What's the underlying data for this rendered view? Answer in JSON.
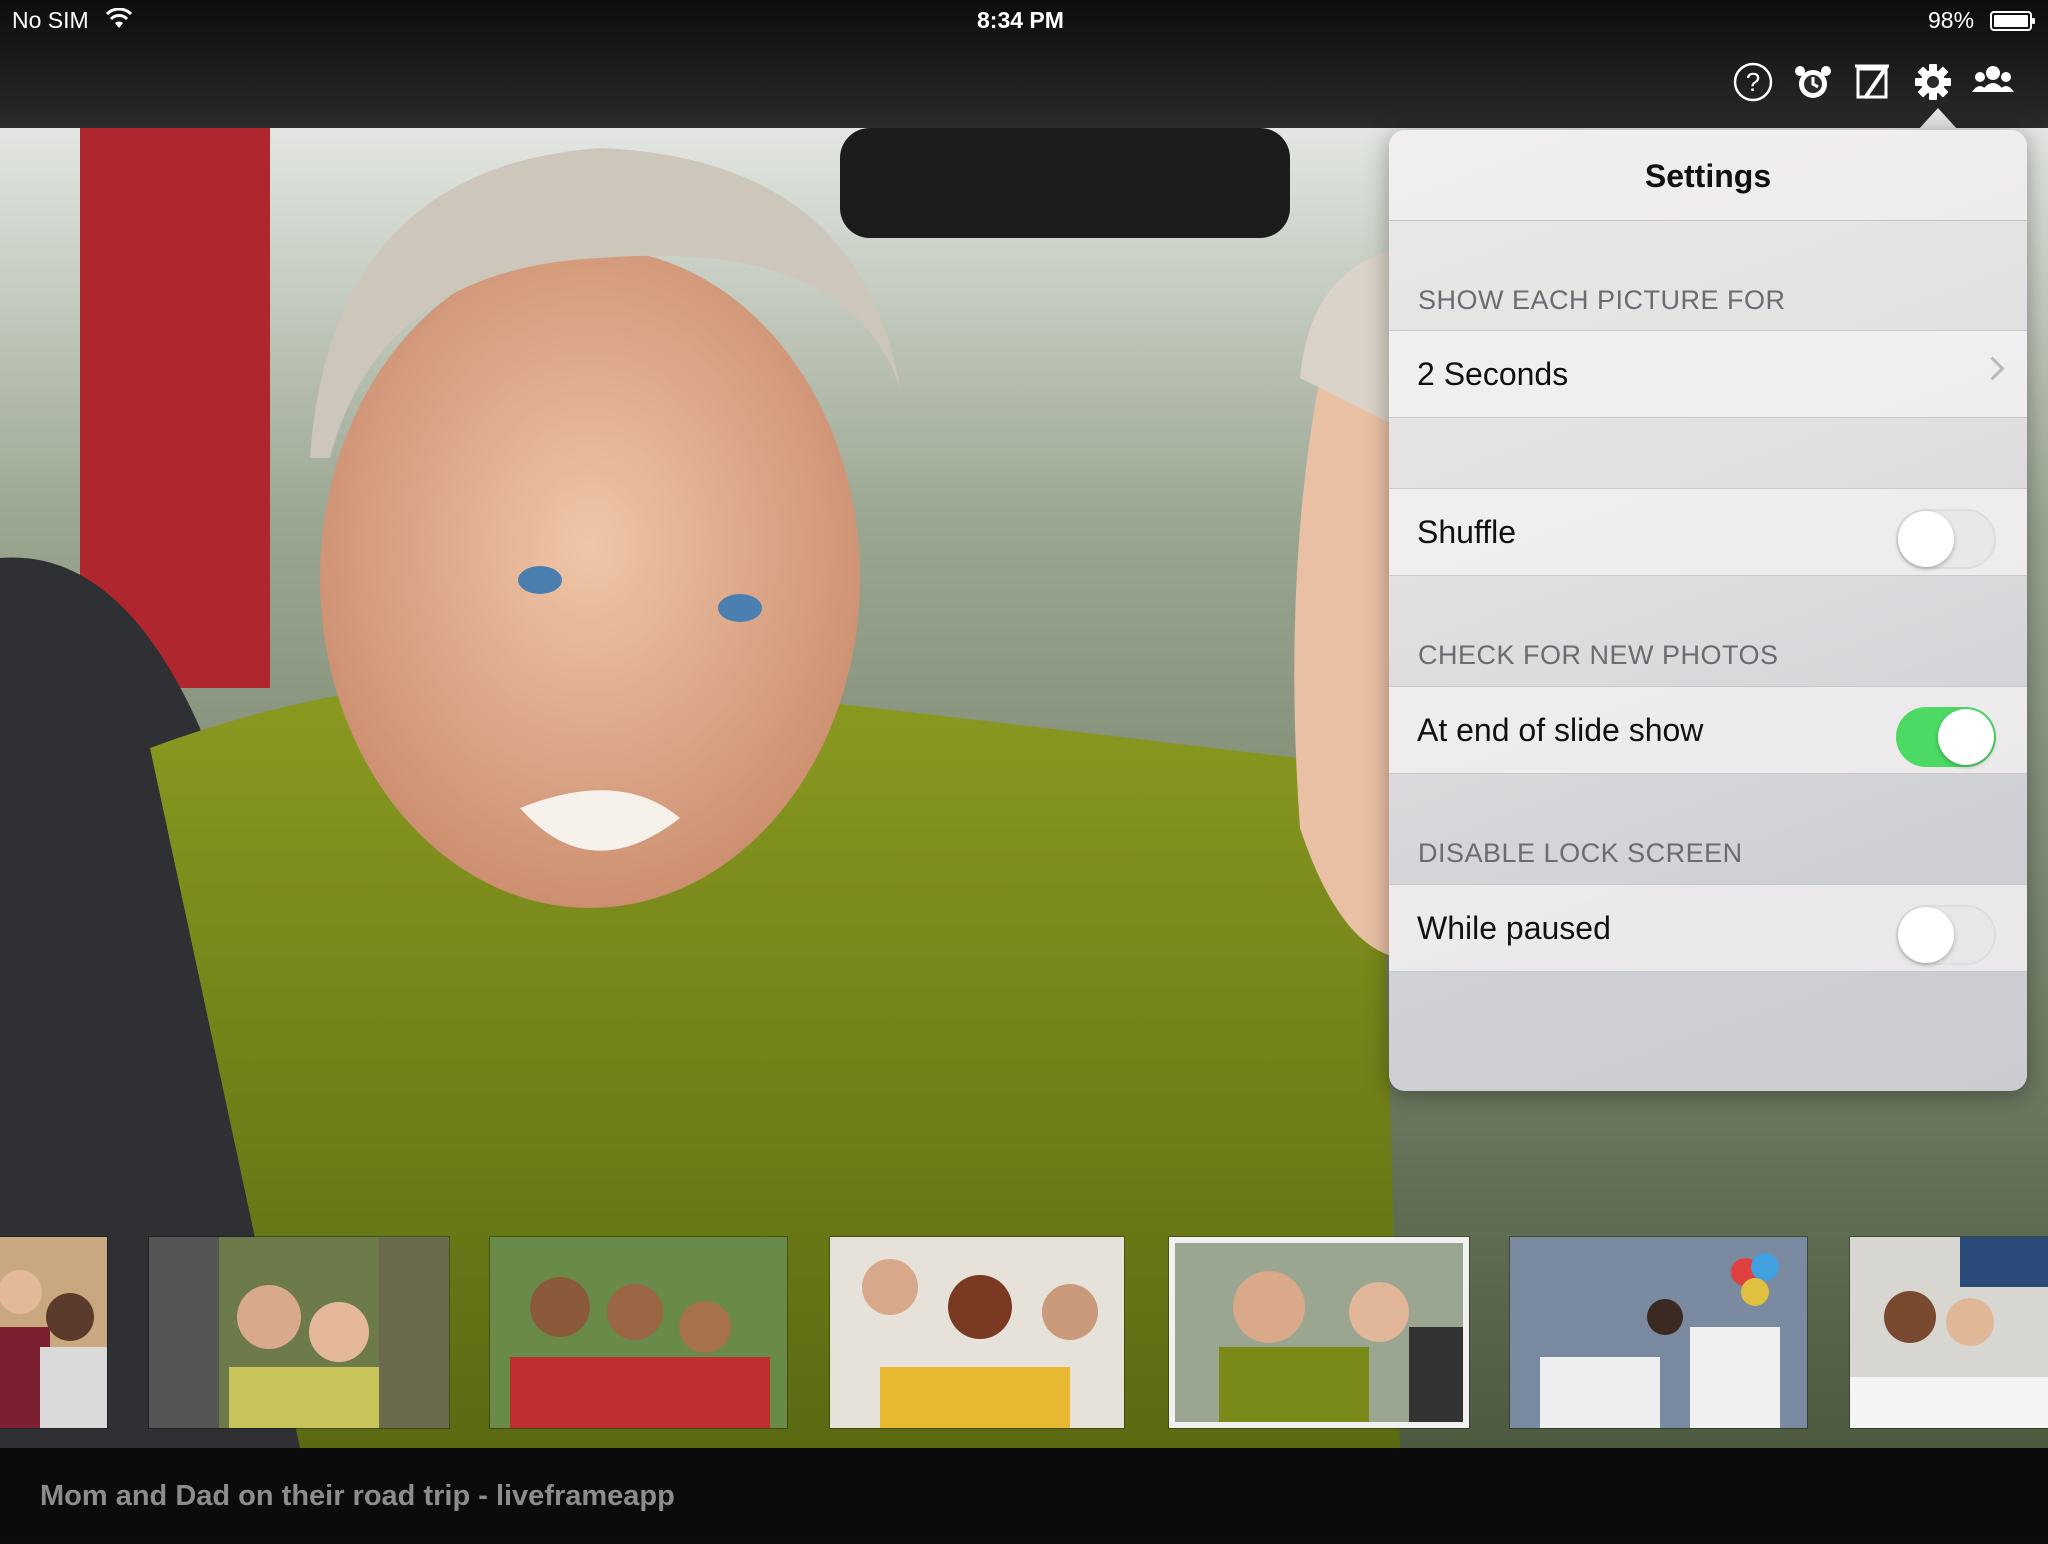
{
  "status_bar": {
    "carrier": "No SIM",
    "time": "8:34 PM",
    "battery": "98%"
  },
  "toolbar": {
    "icons": [
      "help-icon",
      "sleep-timer-icon",
      "edit-frame-icon",
      "gear-icon",
      "people-icon"
    ]
  },
  "settings": {
    "title": "Settings",
    "sections": [
      {
        "header": "SHOW EACH PICTURE FOR",
        "row_label": "2 Seconds",
        "control": "disclosure"
      },
      {
        "header": "",
        "row_label": "Shuffle",
        "control": "switch",
        "on": false
      },
      {
        "header": "CHECK FOR NEW PHOTOS",
        "row_label": "At end of slide show",
        "control": "switch",
        "on": true
      },
      {
        "header": "DISABLE LOCK SCREEN",
        "row_label": "While paused",
        "control": "switch",
        "on": false
      }
    ],
    "switch_on_color": "#4cd964"
  },
  "filmstrip": {
    "selected_index": 4,
    "count": 7
  },
  "caption": "Mom and Dad on their road trip - liveframeapp"
}
